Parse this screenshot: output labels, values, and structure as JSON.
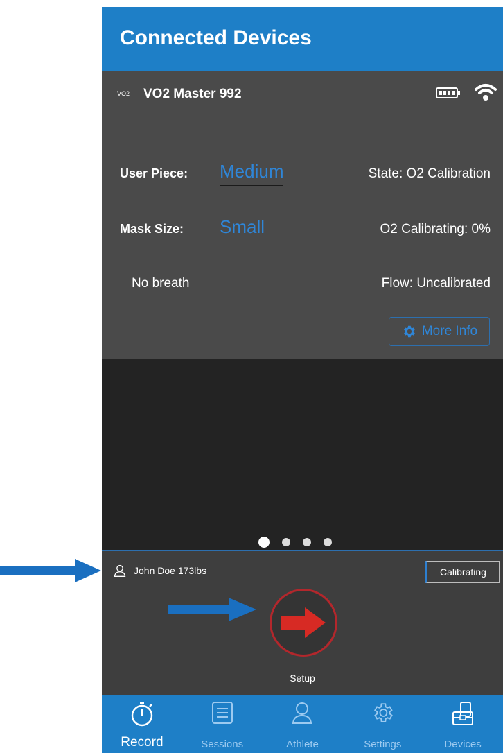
{
  "header": {
    "title": "Connected Devices"
  },
  "device": {
    "logo": "VO2",
    "name": "VO2 Master 992",
    "user_piece_label": "User Piece:",
    "user_piece_value": "Medium",
    "mask_size_label": "Mask Size:",
    "mask_size_value": "Small",
    "state": "State: O2 Calibration",
    "o2_calibrating": "O2 Calibrating: 0%",
    "breath_status": "No breath",
    "flow_status": "Flow: Uncalibrated",
    "more_info_label": "More Info"
  },
  "pager": {
    "count": 4,
    "active_index": 0
  },
  "record_panel": {
    "athlete": "John Doe 173lbs",
    "status_badge": "Calibrating",
    "setup_label": "Setup"
  },
  "nav": {
    "items": [
      {
        "label": "Record",
        "icon": "stopwatch-icon",
        "active": true
      },
      {
        "label": "Sessions",
        "icon": "list-icon",
        "active": false
      },
      {
        "label": "Athlete",
        "icon": "person-icon",
        "active": false
      },
      {
        "label": "Settings",
        "icon": "gear-icon",
        "active": false
      },
      {
        "label": "Devices",
        "icon": "devices-icon",
        "active": false
      }
    ]
  },
  "colors": {
    "primary_blue": "#1e7fc7",
    "value_blue": "#2f86d8",
    "setup_red": "#d72a24",
    "annotation_blue": "#1a6fc0"
  }
}
